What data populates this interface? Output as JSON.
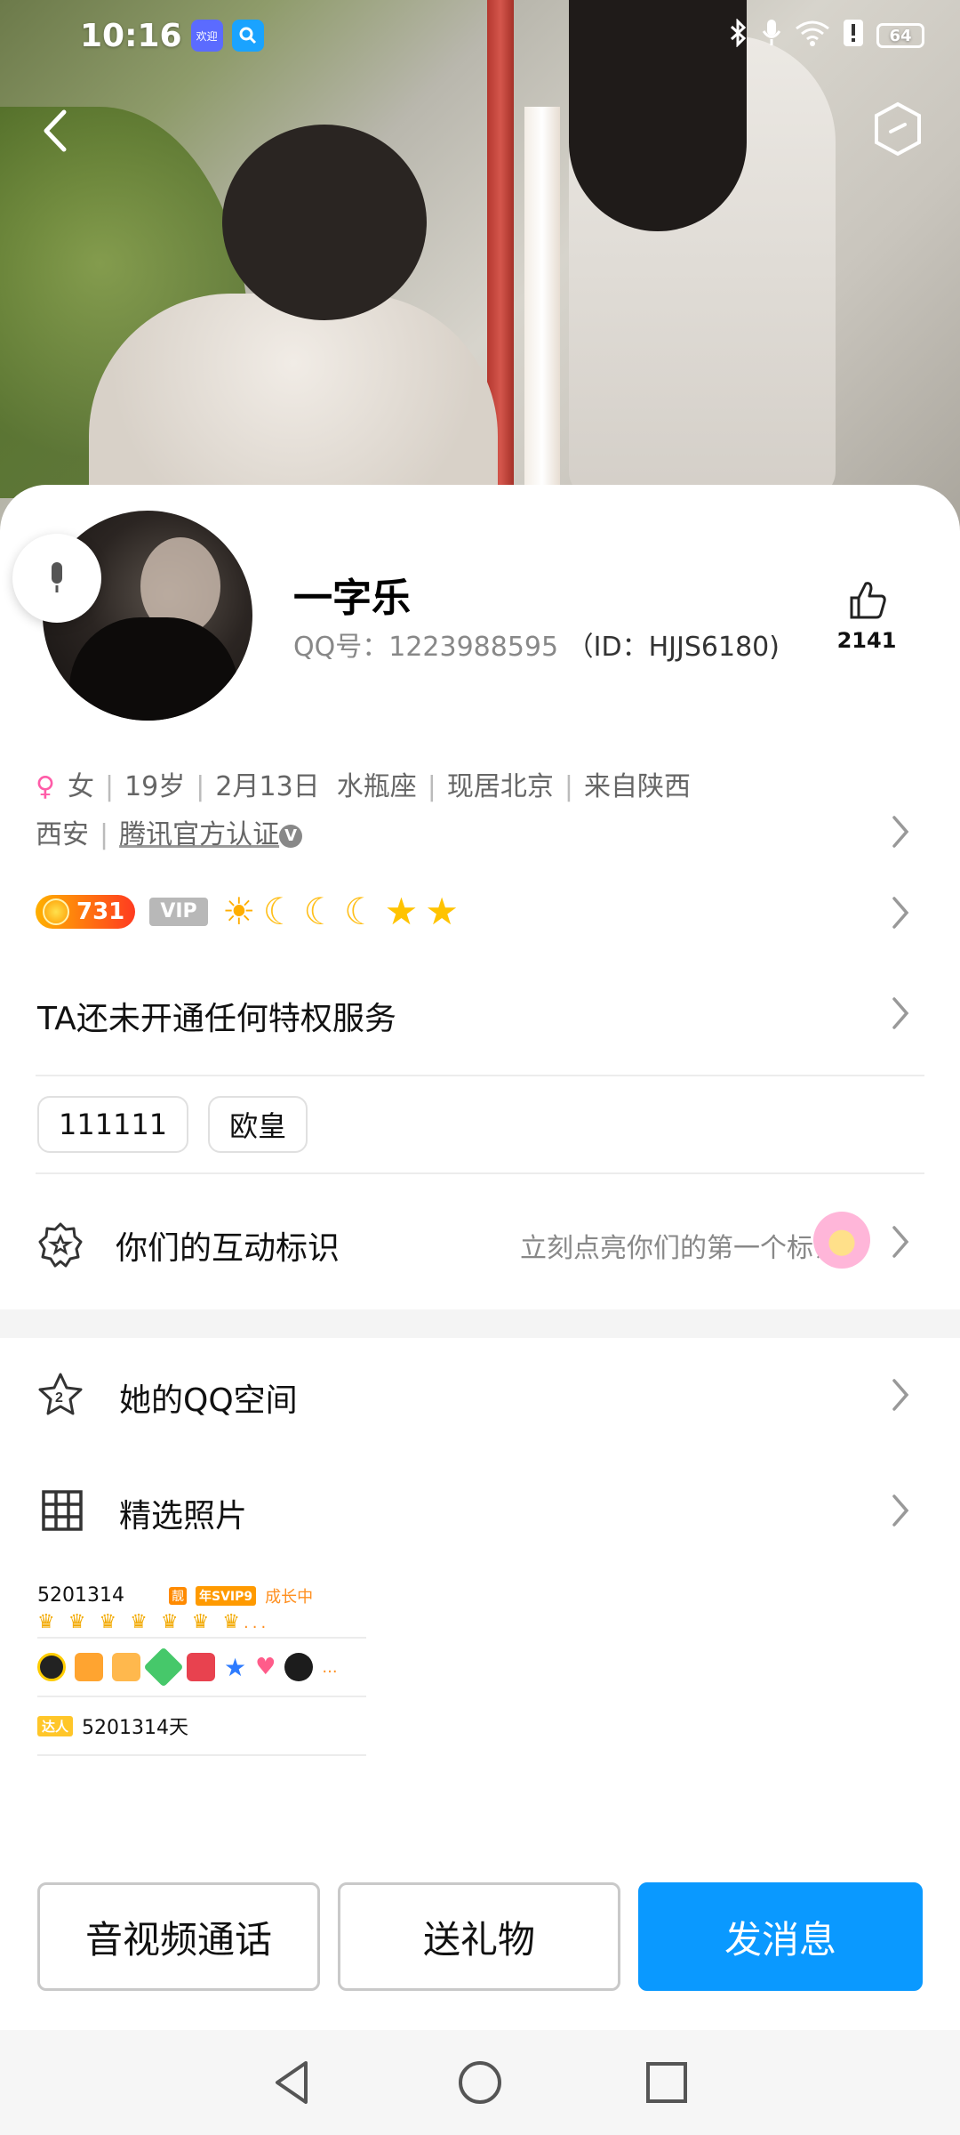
{
  "status_bar": {
    "time": "10:16",
    "app1_label": "欢迎",
    "battery": "64"
  },
  "profile": {
    "name": "一字乐",
    "qq_label": "QQ号：",
    "qq_number": "1223988595",
    "id_text": "（ID：HJJS6180)",
    "likes": "2141"
  },
  "info": {
    "gender": "女",
    "age": "19岁",
    "birthday": "2月13日",
    "zodiac": "水瓶座",
    "residence": "现居北京",
    "hometown_a": "来自陕西",
    "hometown_b": "西安",
    "certification": "腾讯官方认证"
  },
  "levels": {
    "coin_value": "731",
    "vip_label": "VIP"
  },
  "privilege_text": "TA还未开通任何特权服务",
  "tags": [
    "111111",
    "欧皇"
  ],
  "interaction": {
    "label": "你们的互动标识",
    "hint": "立刻点亮你们的第一个标识"
  },
  "menu": {
    "qzone": "她的QQ空间",
    "photos": "精选照片"
  },
  "badges": {
    "number1": "5201314",
    "tag1": "靓",
    "tag2": "年SVIP9",
    "growing": "成长中",
    "ellipsis": "...",
    "daren_label": "达人",
    "days": "5201314天"
  },
  "buttons": {
    "call": "音视频通话",
    "gift": "送礼物",
    "message": "发消息"
  },
  "colors": {
    "primary_blue": "#0a99ff",
    "female_pink": "#ff5ca8",
    "coin_orange": "#ff3b20"
  }
}
